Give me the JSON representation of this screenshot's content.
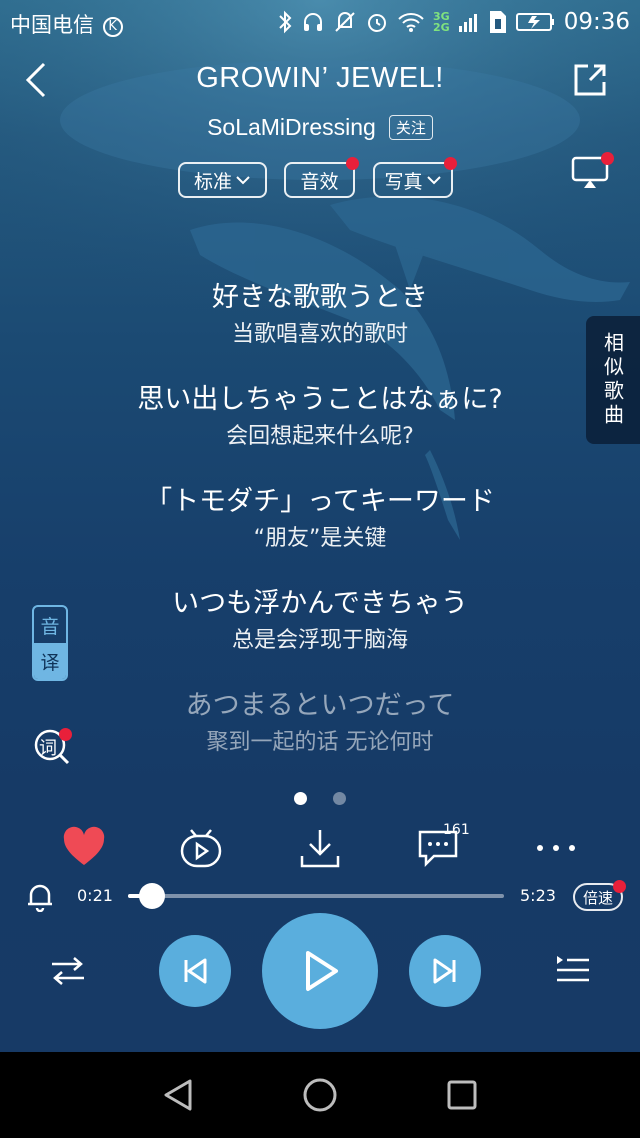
{
  "status_bar": {
    "carrier": "中国电信",
    "network_labels": [
      "3G",
      "2G"
    ],
    "time": "09:36"
  },
  "header": {
    "title": "GROWIN’ JEWEL!",
    "artist": "SoLaMiDressing",
    "follow_label": "关注"
  },
  "options": [
    {
      "label": "标准",
      "has_chevron": true,
      "has_badge": false
    },
    {
      "label": "音效",
      "has_chevron": false,
      "has_badge": true
    },
    {
      "label": "写真",
      "has_chevron": true,
      "has_badge": true
    }
  ],
  "lyrics": [
    {
      "ja": "好きな歌歌うとき",
      "zh": "当歌唱喜欢的歌时"
    },
    {
      "ja": "思い出しちゃうことはなぁに?",
      "zh": "会回想起来什么呢?"
    },
    {
      "ja": "「トモダチ」ってキーワード",
      "zh": "“朋友”是关键"
    },
    {
      "ja": "いつも浮かんできちゃう",
      "zh": "总是会浮现于脑海"
    },
    {
      "ja": "あつまるといつだって",
      "zh": "聚到一起的话 无论何时"
    }
  ],
  "side": {
    "similar_songs_label": "相似歌曲",
    "yin_label": "音",
    "yi_label": "译",
    "ci_label": "词"
  },
  "pager": {
    "total": 2,
    "active": 1
  },
  "actions": {
    "comment_count": "161",
    "icons": [
      "heart-icon",
      "mv-icon",
      "download-icon",
      "comment-icon",
      "more-icon"
    ]
  },
  "progress": {
    "current": "0:21",
    "total": "5:23",
    "fraction": 0.065,
    "speed_label": "倍速"
  },
  "colors": {
    "accent": "#5aaedd",
    "heart": "#ef4a55",
    "badge": "#e8203a"
  }
}
